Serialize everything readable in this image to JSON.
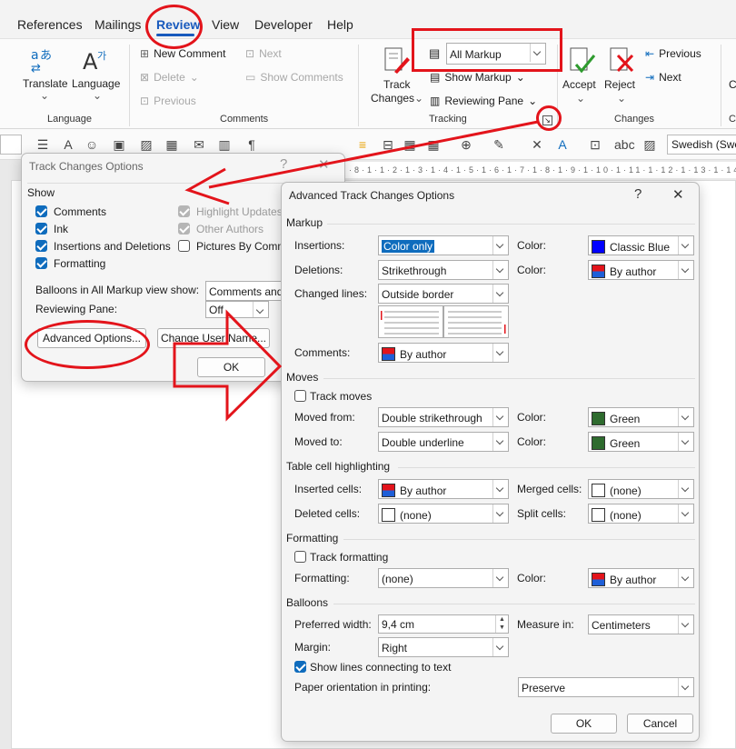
{
  "ribbon": {
    "tabs": [
      "References",
      "Mailings",
      "Review",
      "View",
      "Developer",
      "Help"
    ],
    "translate": "Translate",
    "language": "Language",
    "language_group": "Language",
    "new_comment": "New Comment",
    "delete": "Delete",
    "previous_comment": "Previous",
    "next_comment": "Next",
    "show_comments": "Show Comments",
    "comments_group": "Comments",
    "track_changes_1": "Track",
    "track_changes_2": "Changes",
    "markup_select": "All Markup",
    "show_markup": "Show Markup",
    "reviewing_pane": "Reviewing Pane",
    "tracking_group": "Tracking",
    "accept": "Accept",
    "reject": "Reject",
    "previous_change": "Previous",
    "next_change": "Next",
    "changes_group": "Changes",
    "edge_c1": "C",
    "edge_c2": "C"
  },
  "toolbar": {
    "language_value": "Swedish (Swe"
  },
  "track_dialog": {
    "title": "Track Changes Options",
    "show_label": "Show",
    "comments": "Comments",
    "ink": "Ink",
    "insertions_deletions": "Insertions and Deletions",
    "formatting": "Formatting",
    "highlight_updates": "Highlight Updates",
    "other_authors": "Other Authors",
    "pictures_by_comments": "Pictures By Comme",
    "balloons_label": "Balloons in All Markup view show:",
    "balloons_value": "Comments and f",
    "reviewing_pane_label": "Reviewing Pane:",
    "reviewing_pane_value": "Off",
    "advanced_button": "Advanced Options...",
    "change_user_button": "Change User Name...",
    "ok": "OK"
  },
  "adv": {
    "title": "Advanced Track Changes Options",
    "help": "?",
    "markup_section": "Markup",
    "insertions_label": "Insertions:",
    "insertions_value": "Color only",
    "color_label": "Color:",
    "insertions_color": "Classic Blue",
    "deletions_label": "Deletions:",
    "deletions_value": "Strikethrough",
    "deletions_color": "By author",
    "changed_lines_label": "Changed lines:",
    "changed_lines_value": "Outside border",
    "comments_label": "Comments:",
    "comments_value": "By author",
    "moves_section": "Moves",
    "track_moves": "Track moves",
    "moved_from_label": "Moved from:",
    "moved_from_value": "Double strikethrough",
    "moved_from_color": "Green",
    "moved_to_label": "Moved to:",
    "moved_to_value": "Double underline",
    "moved_to_color": "Green",
    "table_section": "Table cell highlighting",
    "inserted_cells_label": "Inserted cells:",
    "inserted_cells_value": "By author",
    "merged_cells_label": "Merged cells:",
    "merged_cells_value": "(none)",
    "deleted_cells_label": "Deleted cells:",
    "deleted_cells_value": "(none)",
    "split_cells_label": "Split cells:",
    "split_cells_value": "(none)",
    "formatting_section": "Formatting",
    "track_formatting": "Track formatting",
    "formatting_label": "Formatting:",
    "formatting_value": "(none)",
    "formatting_color": "By author",
    "balloons_section": "Balloons",
    "preferred_width_label": "Preferred width:",
    "preferred_width_value": "9,4 cm",
    "measure_in_label": "Measure in:",
    "measure_in_value": "Centimeters",
    "margin_label": "Margin:",
    "margin_value": "Right",
    "show_lines": "Show lines connecting to text",
    "paper_orientation_label": "Paper orientation in printing:",
    "paper_orientation_value": "Preserve",
    "ok": "OK",
    "cancel": "Cancel"
  },
  "colors": {
    "annotation_red": "#e3141b",
    "accent_blue": "#0f6cbd",
    "classic_blue": "#0000ff",
    "green": "#2e6b2e"
  }
}
